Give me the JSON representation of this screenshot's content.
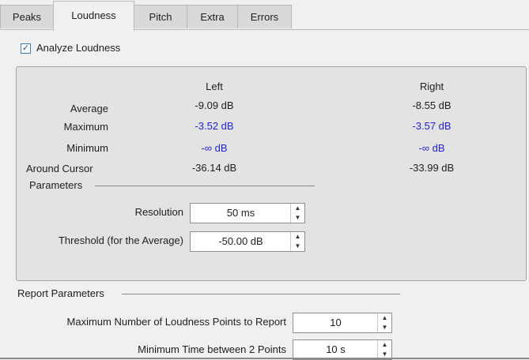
{
  "tabs": [
    "Peaks",
    "Loudness",
    "Pitch",
    "Extra",
    "Errors"
  ],
  "analyze": {
    "label": "Analyze Loudness",
    "checked": true
  },
  "columns": {
    "left": "Left",
    "right": "Right"
  },
  "rows": [
    {
      "label": "Average",
      "left": "-9.09 dB",
      "right": "-8.55 dB"
    },
    {
      "label": "Maximum",
      "left": "-3.52 dB",
      "right": "-3.57 dB"
    },
    {
      "label": "Minimum",
      "left": "-∞ dB",
      "right": "-∞ dB"
    },
    {
      "label": "Around Cursor",
      "left": "-36.14 dB",
      "right": "-33.99 dB"
    }
  ],
  "parameters": {
    "title": "Parameters",
    "resolution": {
      "label": "Resolution",
      "value": "50 ms"
    },
    "threshold": {
      "label": "Threshold (for the Average)",
      "value": "-50.00 dB"
    }
  },
  "report": {
    "title": "Report Parameters",
    "max_points": {
      "label": "Maximum Number of Loudness Points to Report",
      "value": "10"
    },
    "min_time": {
      "label": "Minimum Time between 2 Points",
      "value": "10 s"
    }
  },
  "colors": {
    "accent_text": "#1f1fe0",
    "panel_bg": "#e3e3e3",
    "window_bg": "#f0f0f0"
  }
}
